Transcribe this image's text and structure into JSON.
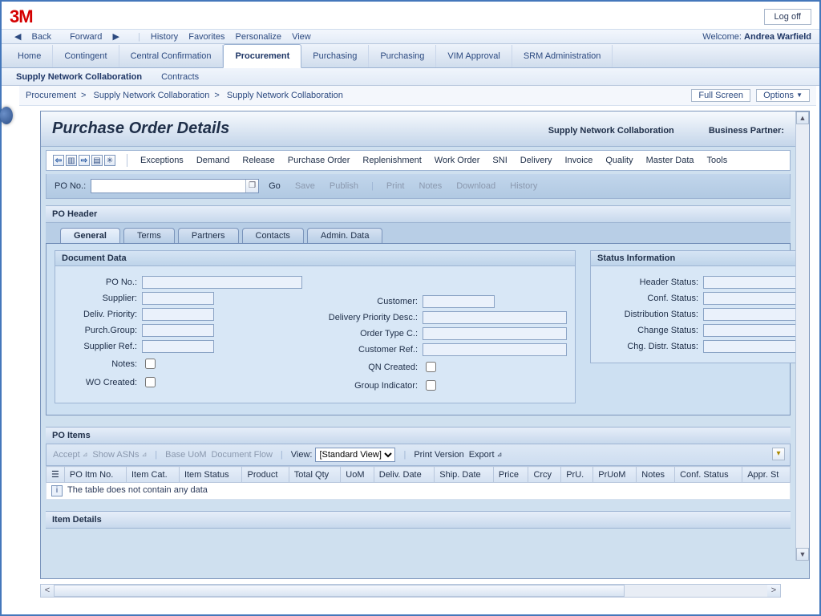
{
  "header": {
    "logo": "3M",
    "logoff": "Log off",
    "back": "Back",
    "forward": "Forward",
    "history": "History",
    "favorites": "Favorites",
    "personalize": "Personalize",
    "view": "View",
    "welcome_prefix": "Welcome: ",
    "welcome_user": "Andrea Warfield"
  },
  "main_tabs": {
    "items": [
      "Home",
      "Contingent",
      "Central Confirmation",
      "Procurement",
      "Purchasing",
      "Purchasing",
      "VIM Approval",
      "SRM Administration"
    ],
    "active": "Procurement"
  },
  "sub_tabs": {
    "items": [
      "Supply Network Collaboration",
      "Contracts"
    ],
    "active": "Supply Network Collaboration"
  },
  "crumbs": {
    "a": "Procurement",
    "b": "Supply Network Collaboration",
    "c": "Supply Network Collaboration"
  },
  "rightbtns": {
    "full": "Full Screen",
    "options": "Options"
  },
  "title": {
    "text": "Purchase Order Details",
    "right1": "Supply Network Collaboration",
    "right2": "Business Partner:"
  },
  "menu": {
    "items": [
      "Exceptions",
      "Demand",
      "Release",
      "Purchase Order",
      "Replenishment",
      "Work Order",
      "SNI",
      "Delivery",
      "Invoice",
      "Quality",
      "Master Data",
      "Tools"
    ]
  },
  "toolbar": {
    "pono_label": "PO No.:",
    "go": "Go",
    "save": "Save",
    "publish": "Publish",
    "print": "Print",
    "notes": "Notes",
    "download": "Download",
    "history": "History"
  },
  "po_header": {
    "title": "PO Header",
    "tabs": [
      "General",
      "Terms",
      "Partners",
      "Contacts",
      "Admin. Data"
    ],
    "active": "General"
  },
  "docdata": {
    "title": "Document Data",
    "left": {
      "pono": "PO No.:",
      "supplier": "Supplier:",
      "deliv": "Deliv. Priority:",
      "purch": "Purch.Group:",
      "sref": "Supplier Ref.:",
      "notes": "Notes:",
      "wo": "WO Created:"
    },
    "right": {
      "customer": "Customer:",
      "dpd": "Delivery Priority Desc.:",
      "otc": "Order Type C.:",
      "cref": "Customer Ref.:",
      "qn": "QN Created:",
      "gi": "Group Indicator:"
    }
  },
  "status": {
    "title": "Status Information",
    "labels": [
      "Header Status:",
      "Conf. Status:",
      "Distribution Status:",
      "Change Status:",
      "Chg. Distr. Status:"
    ]
  },
  "po_items": {
    "title": "PO Items",
    "tools": {
      "accept": "Accept",
      "show": "Show ASNs",
      "base": "Base UoM",
      "docflow": "Document Flow",
      "view": "View:",
      "view_sel": "[Standard View]",
      "print": "Print Version",
      "export": "Export"
    },
    "cols": [
      "PO Itm No.",
      "Item Cat.",
      "Item Status",
      "Product",
      "Total Qty",
      "UoM",
      "Deliv. Date",
      "Ship. Date",
      "Price",
      "Crcy",
      "PrU.",
      "PrUoM",
      "Notes",
      "Conf. Status",
      "Appr. St"
    ],
    "empty": "The table does not contain any data"
  },
  "item_details": {
    "title": "Item Details"
  }
}
